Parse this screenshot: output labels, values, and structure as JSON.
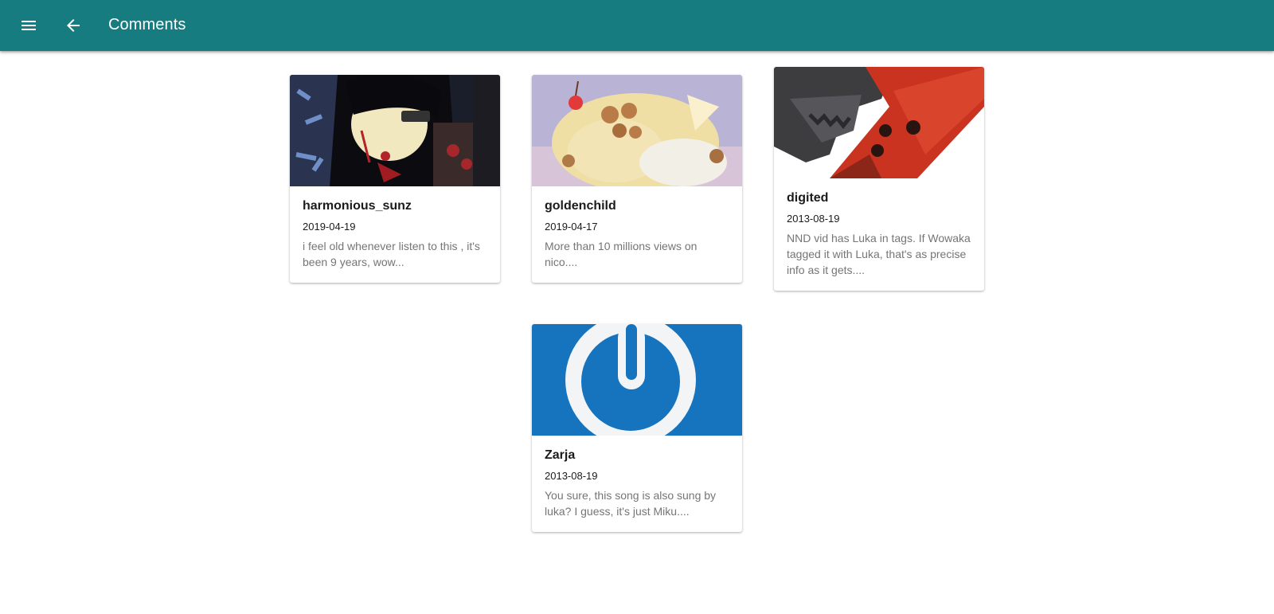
{
  "header": {
    "title": "Comments",
    "menu_icon": "menu-icon",
    "back_icon": "arrow-back-icon",
    "background": "#167c80"
  },
  "comments": [
    {
      "user": "harmonious_sunz",
      "date": "2019-04-19",
      "text": "i feel old whenever listen to this , it's been 9 years, wow..."
    },
    {
      "user": "goldenchild",
      "date": "2019-04-17",
      "text": "More than 10 millions views on nico...."
    },
    {
      "user": "digited",
      "date": "2013-08-19",
      "text": "NND vid has Luka in tags. If Wowaka tagged it with Luka, that's as precise info as it gets...."
    },
    {
      "user": "Zarja",
      "date": "2013-08-19",
      "text": "You sure, this song is also sung by luka? I guess, it's just Miku...."
    }
  ]
}
